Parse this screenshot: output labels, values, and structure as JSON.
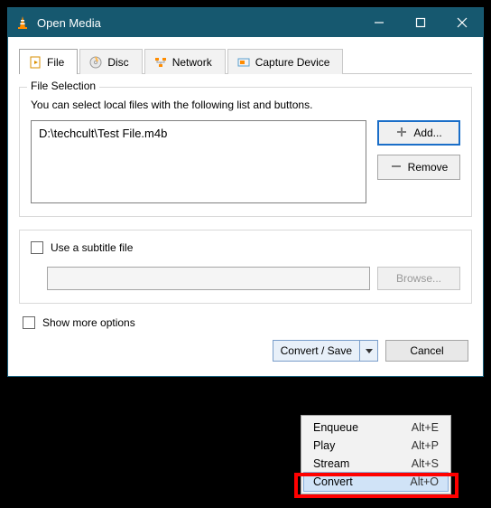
{
  "window": {
    "title": "Open Media"
  },
  "tabs": {
    "file": "File",
    "disc": "Disc",
    "network": "Network",
    "capture": "Capture Device"
  },
  "file_selection": {
    "title": "File Selection",
    "desc": "You can select local files with the following list and buttons.",
    "entry": "D:\\techcult\\Test File.m4b",
    "add": "Add...",
    "remove": "Remove"
  },
  "subtitle": {
    "label": "Use a subtitle file",
    "browse": "Browse..."
  },
  "show_more": "Show more options",
  "footer": {
    "convert_save": "Convert / Save",
    "cancel": "Cancel"
  },
  "menu": {
    "items": [
      {
        "name": "Enqueue",
        "shortcut": "Alt+E"
      },
      {
        "name": "Play",
        "shortcut": "Alt+P"
      },
      {
        "name": "Stream",
        "shortcut": "Alt+S"
      },
      {
        "name": "Convert",
        "shortcut": "Alt+O"
      }
    ]
  }
}
